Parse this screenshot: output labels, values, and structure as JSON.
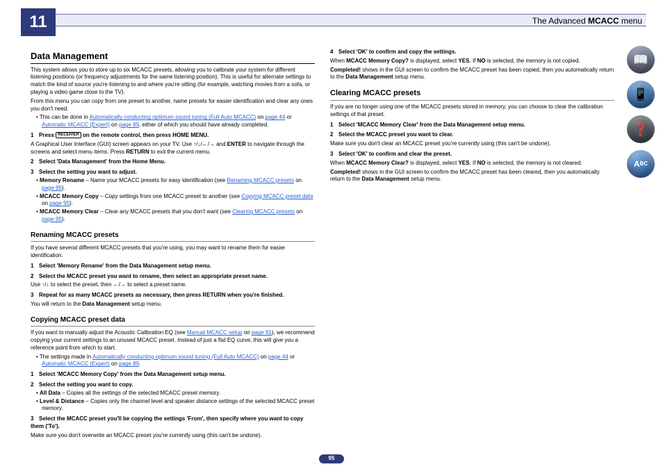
{
  "chapter": "11",
  "header": {
    "title_pre": "The Advanced ",
    "title_bold": "MCACC",
    "title_post": " menu"
  },
  "page_number": "95",
  "left": {
    "h_data_mgmt": "Data Management",
    "dm_intro": "This system allows you to store up to six MCACC presets, allowing you to calibrate your system for different listening positions (or frequency adjustments for the same listening position). This is useful for alternate settings to match the kind of source you're listening to and where you're sitting (for example, watching movies from a sofa, or playing a video game close to the TV).",
    "dm_intro2": "From this menu you can copy from one preset to another, name presets for easier identification and clear any ones you don't need.",
    "dm_bul1_pre": "This can be done in ",
    "dm_bul1_link1": "Automatically conducting optimum sound tuning (Full Auto MCACC)",
    "dm_bul1_mid": " on ",
    "dm_bul1_link_pg1": "page 44",
    "dm_bul1_or": " or ",
    "dm_bul1_link2": "Automatic MCACC (Expert)",
    "dm_bul1_on": " on ",
    "dm_bul1_link_pg2": "page 89",
    "dm_bul1_end": ", either of which you should have already completed.",
    "dm_step1_pre": "Press ",
    "dm_step1_post": " on the remote control, then press HOME MENU.",
    "dm_step1_body_a": "A Graphical User Interface (GUI) screen appears on your TV. Use ",
    "dm_step1_body_b": " and ",
    "dm_step1_body_c": " to navigate through the screens and select menu items. Press ",
    "dm_step1_body_d": " to exit the current menu.",
    "dm_step2": "Select 'Data Management' from the Home Menu.",
    "dm_step3": "Select the setting you want to adjust.",
    "dm_b1_pre": "Memory Rename",
    "dm_b1_txt": " – Name your MCACC presets for easy identification (see ",
    "dm_b1_link": "Renaming MCACC presets",
    "dm_b1_on": " on ",
    "dm_b1_pg": "page 95",
    "dm_b1_end": ").",
    "dm_b2_pre": "MCACC Memory Copy",
    "dm_b2_txt": " – Copy settings from one MCACC preset to another (see ",
    "dm_b2_link": "Copying MCACC preset data",
    "dm_b2_on": " on ",
    "dm_b2_pg": "page 95",
    "dm_b2_end": ").",
    "dm_b3_pre": "MCACC Memory Clear",
    "dm_b3_txt": " – Clear any MCACC presets that you don't want (see ",
    "dm_b3_link": "Clearing MCACC presets",
    "dm_b3_on": " on ",
    "dm_b3_pg": "page 95",
    "dm_b3_end": ").",
    "h_rename": "Renaming MCACC presets",
    "rn_intro": "If you have several different MCACC presets that you're using, you may want to rename them for easier identification.",
    "rn_step1": "Select 'Memory Rename' from the Data Management setup menu.",
    "rn_step2": "Select the MCACC preset you want to rename, then select an appropriate preset name.",
    "rn_step2_body_a": "Use ",
    "rn_step2_body_b": " to select the preset, then ",
    "rn_step2_body_c": " to select a preset name.",
    "rn_step3": "Repeat for as many MCACC presets as necessary, then press RETURN when you're finished.",
    "rn_step3_body_a": "You will return to the ",
    "rn_step3_body_b": "Data Management",
    "rn_step3_body_c": " setup menu.",
    "h_copy": "Copying MCACC preset data",
    "cp_intro_a": "If you want to manually adjust the Acoustic Calibration EQ (see ",
    "cp_intro_link": "Manual MCACC setup",
    "cp_intro_on": " on ",
    "cp_intro_pg": "page 91",
    "cp_intro_b": "), we recommend copying your current settings to an unused MCACC preset. Instead of just a flat EQ curve, this will give you a reference point from which to start.",
    "cp_bul_pre": "The settings made in ",
    "cp_bul_link1": "Automatically conducting optimum sound tuning (Full Auto MCACC)",
    "cp_bul_on1": " on ",
    "cp_bul_pg1": "page 44",
    "cp_bul_or": " or ",
    "cp_bul_link2": "Automatic MCACC (Expert)",
    "cp_bul_on2": " on ",
    "cp_bul_pg2": "page 89",
    "cp_bul_end": ".",
    "cp_step1": "Select 'MCACC Memory Copy' from the Data Management setup menu.",
    "cp_step2": "Select the setting you want to copy.",
    "cp_b1_pre": "All Data",
    "cp_b1_txt": " – Copies all the settings of the selected MCACC preset memory.",
    "cp_b2_pre": "Level & Distance",
    "cp_b2_txt": " – Copies only the channel level and speaker distance settings of the selected MCACC preset memory.",
    "cp_step3": "Select the MCACC preset you'll be copying the settings 'From', then specify where you want to copy them ('To').",
    "cp_step3_body": "Make sure you don't overwrite an MCACC preset you're currently using (this can't be undone)."
  },
  "right": {
    "cp_step4": "Select 'OK' to confirm and copy the settings.",
    "cp_step4_body_a": "When ",
    "cp_step4_body_b": "MCACC Memory Copy?",
    "cp_step4_body_c": " is displayed, select ",
    "cp_step4_body_d": "YES",
    "cp_step4_body_e": ". If ",
    "cp_step4_body_f": "NO",
    "cp_step4_body_g": " is selected, the memory is not copied.",
    "cp_step4_body2_a": "Completed!",
    "cp_step4_body2_b": " shows in the GUI screen to confirm the MCACC preset has been copied, then you automatically return to the ",
    "cp_step4_body2_c": "Data Management",
    "cp_step4_body2_d": " setup menu.",
    "h_clear": "Clearing MCACC presets",
    "cl_intro": "If you are no longer using one of the MCACC presets stored in memory, you can choose to clear the calibration settings of that preset.",
    "cl_step1": "Select 'MCACC Memory Clear' from the Data Management setup menu.",
    "cl_step2": "Select the MCACC preset you want to clear.",
    "cl_step2_body": "Make sure you don't clear an MCACC preset you're currently using (this can't be undone).",
    "cl_step3": "Select 'OK' to confirm and clear the preset.",
    "cl_step3_body_a": "When ",
    "cl_step3_body_b": "MCACC Memory Clear?",
    "cl_step3_body_c": " is displayed, select ",
    "cl_step3_body_d": "YES",
    "cl_step3_body_e": ". If ",
    "cl_step3_body_f": "NO",
    "cl_step3_body_g": " is selected, the memory is not cleared.",
    "cl_step3_body2_a": "Completed!",
    "cl_step3_body2_b": " shows in the GUI screen to confirm the MCACC preset has been cleared, then you automatically return to the ",
    "cl_step3_body2_c": "Data Management",
    "cl_step3_body2_d": " setup menu."
  },
  "keys": {
    "receiver": "RECEIVER",
    "enter": "ENTER",
    "return": "RETURN"
  },
  "arrows": {
    "updown": "↑/↓",
    "leftright": "←/→",
    "all": "↑/↓/←/→"
  }
}
